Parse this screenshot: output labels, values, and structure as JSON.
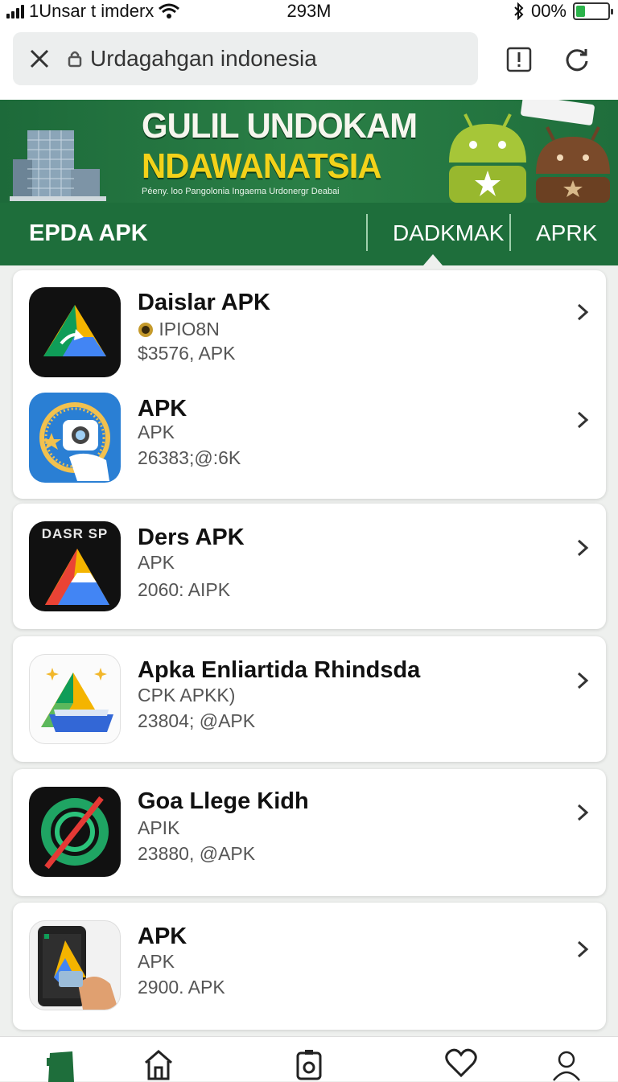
{
  "status": {
    "carrier": "1Unsar t imderx",
    "time": "293M",
    "battery": "00%",
    "battery_level": 0.3,
    "icons": [
      "signal-icon",
      "wifi-icon",
      "bluetooth-icon",
      "battery-icon"
    ]
  },
  "browser": {
    "url": "Urdagahgan indonesia",
    "icons": [
      "close-icon",
      "lock-icon",
      "alert-icon",
      "reload-icon"
    ]
  },
  "banner": {
    "title_line1": "GULIL UNDOKAM",
    "title_line2": "NDAWANATSIA",
    "subtitle": "Péeny. loo Pangolonia  Ingaema Urdonergr Deabai"
  },
  "nav": {
    "brand": "EPDA APK",
    "tabs": [
      "DADKMAK",
      "APRK"
    ]
  },
  "apps": [
    {
      "name": "Daislar APK",
      "sub": "IPIO8N",
      "meta": "$3576, APK",
      "icon": "drive-dark-icon"
    },
    {
      "name": "APK",
      "sub": "APK",
      "meta": "26383;@:6K",
      "icon": "camera-badge-icon"
    },
    {
      "name": "Ders APK",
      "sub": "APK",
      "meta": "2060: AIPK",
      "icon": "dasr-drive-icon",
      "icon_text": "DASR SP"
    },
    {
      "name": "Apka Enliartida Rhindsda",
      "sub": "CPK  APKK)",
      "meta": "23804; @APK",
      "icon": "drive-sparkle-icon"
    },
    {
      "name": "Goa Llege Kidh",
      "sub": "APIK",
      "meta": "23880, @APK",
      "icon": "ring-slash-icon"
    },
    {
      "name": "APK",
      "sub": "APK",
      "meta": "2900. APK",
      "icon": "phone-hand-icon"
    }
  ],
  "bottom_tabs": [
    "apk-store-icon",
    "home-icon",
    "camera-icon",
    "heart-icon",
    "profile-icon"
  ],
  "colors": {
    "brand_green": "#1e6e3b",
    "banner_yellow": "#f3d21a"
  }
}
